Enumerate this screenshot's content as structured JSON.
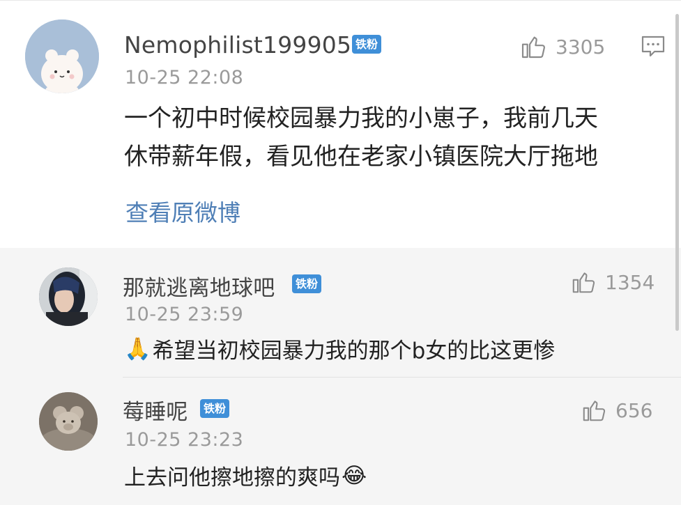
{
  "main_comment": {
    "username": "Nemophilist199905",
    "badge": "铁粉",
    "time": "10-25 22:08",
    "likes": "3305",
    "avatar": "white-bear-avatar",
    "text_lines": [
      "一个初中时候校园暴力我的小崽子，我前几天",
      "休带薪年假，看见他在老家小镇医院大厅拖地"
    ],
    "view_original": "查看原微博",
    "like_icon": "thumbs-up-icon",
    "reply_icon": "comment-icon"
  },
  "replies": [
    {
      "username": "那就逃离地球吧",
      "badge": "铁粉",
      "time": "10-25 23:59",
      "likes": "1354",
      "avatar": "girl-photo-avatar",
      "emoji": "🙏",
      "emoji_name": "folded-hands-emoji",
      "text": "希望当初校园暴力我的那个b女的比这更惨"
    },
    {
      "username": "莓睡呢",
      "badge": "铁粉",
      "time": "10-25 23:23",
      "likes": "656",
      "avatar": "teddy-bear-avatar",
      "emoji": "😂",
      "emoji_name": "laughing-emoji",
      "text": "上去问他擦地擦的爽吗"
    }
  ],
  "colors": {
    "badge": "#3f8fd8",
    "link": "#4f7fb6",
    "meta_gray": "#9a9a9a",
    "reply_bg": "#f5f5f5"
  }
}
